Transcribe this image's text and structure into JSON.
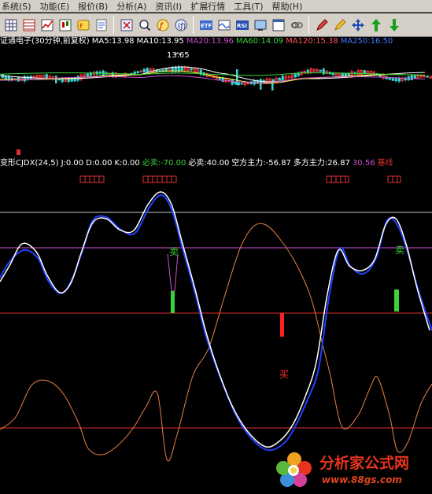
{
  "menu": [
    "系统(S)",
    "功能(E)",
    "报价(B)",
    "分析(A)",
    "资讯(I)",
    "扩展行情",
    "工具(T)",
    "帮助(H)"
  ],
  "toolbar_icons": [
    "grid-icon",
    "table-icon",
    "line-chart-icon",
    "candle-chart-icon",
    "f10-icon",
    "notepad-icon",
    "scissors-icon",
    "magnifier-icon",
    "hand-icon",
    "f-icon",
    "etf-icon",
    "wave-icon",
    "rsi-icon",
    "screen-icon",
    "window-icon",
    "link-icon",
    "pen-icon",
    "pencil-icon",
    "move-icon",
    "up-arrow-icon",
    "down-arrow-icon"
  ],
  "toolbar_labels": {
    "rsi": "RSI",
    "etf": "ETF"
  },
  "main_legend": [
    {
      "text": "证通电子(30分钟,前复权)",
      "color": "#ffffff"
    },
    {
      "text": "MA5:13.98",
      "color": "#ffffff"
    },
    {
      "text": "MA10:13.95",
      "color": "#ffffff"
    },
    {
      "text": "MA20:13.96",
      "color": "#d050d0"
    },
    {
      "text": "MA60:14.09",
      "color": "#3cd23c"
    },
    {
      "text": "MA120:15.38",
      "color": "#ff5555"
    },
    {
      "text": "MA250:16.50",
      "color": "#4a7aff"
    }
  ],
  "price_marker": "13.65",
  "indicator_legend": [
    {
      "text": "变形CJDX(24,5)",
      "color": "#ffffff"
    },
    {
      "text": "J:0.00",
      "color": "#ffffff"
    },
    {
      "text": "D:0.00",
      "color": "#ffffff"
    },
    {
      "text": "K:0.00",
      "color": "#ffffff"
    },
    {
      "text": "必卖:-70.00",
      "color": "#3cd23c"
    },
    {
      "text": "必卖:40.00",
      "color": "#ffffff"
    },
    {
      "text": "空方主力:-56.87",
      "color": "#ffffff"
    },
    {
      "text": "多方主力:26.87",
      "color": "#ffffff"
    },
    {
      "text": "30.56",
      "color": "#d050d0"
    },
    {
      "text": "基线",
      "color": "#e03030"
    }
  ],
  "signals": {
    "sell": "卖",
    "buy": "买"
  },
  "watermark": {
    "title": "分析家公式网",
    "url": "www.88gs.com"
  },
  "colors": {
    "up": "#ff3a3a",
    "down": "#3cd2d2",
    "white_line": "#ffffff",
    "blue_line": "#2040ff",
    "orange_line": "#e88040",
    "magenta": "#d050d0",
    "red_hline": "#e03030"
  }
}
